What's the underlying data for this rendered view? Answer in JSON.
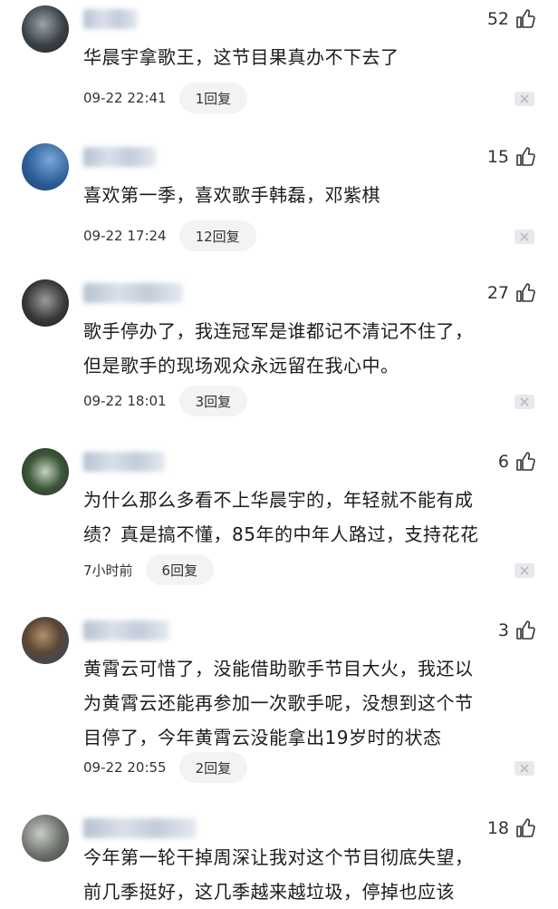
{
  "comments": [
    {
      "likes": "52",
      "text_lines": [
        "华晨宇拿歌王，这节目果真办不下去了"
      ],
      "time": "09-22 22:41",
      "reply_label": "1回复",
      "avatar_colors": [
        "#3b4046",
        "#9aa3ab",
        "#22262a"
      ],
      "username_width": 60
    },
    {
      "likes": "15",
      "text_lines": [
        "喜欢第一季，喜欢歌手韩磊，邓紫棋"
      ],
      "time": "09-22 17:24",
      "reply_label": "12回复",
      "avatar_colors": [
        "#2d5f9a",
        "#7aa7d6",
        "#1d3f6b"
      ],
      "username_width": 80
    },
    {
      "likes": "27",
      "text_lines": [
        "歌手停办了，我连冠军是谁都记不清记不住了，",
        "但是歌手的现场观众永远留在我心中。"
      ],
      "time": "09-22 18:01",
      "reply_label": "3回复",
      "avatar_colors": [
        "#3a3a3a",
        "#9b9b9b",
        "#151515"
      ],
      "username_width": 110
    },
    {
      "likes": "6",
      "text_lines": [
        "为什么那么多看不上华晨宇的，年轻就不能有成",
        "绩？真是搞不懂，85年的中年人路过，支持花花"
      ],
      "time": "7小时前",
      "reply_label": "6回复",
      "avatar_colors": [
        "#3f5a3b",
        "#c7d3c2",
        "#1f2a1d"
      ],
      "username_width": 90
    },
    {
      "likes": "3",
      "text_lines": [
        "黄霄云可惜了，没能借助歌手节目大火，我还以",
        "为黄霄云还能再参加一次歌手呢，没想到这个节",
        "目停了，今年黄霄云没能拿出19岁时的状态"
      ],
      "time": "09-22 20:55",
      "reply_label": "2回复",
      "avatar_colors": [
        "#5b4634",
        "#b08f6d",
        "#2b4a73"
      ],
      "username_width": 95
    },
    {
      "likes": "18",
      "text_lines": [
        "今年第一轮干掉周深让我对这个节目彻底失望，",
        "前几季挺好，这几季越来越垃圾，停掉也应该"
      ],
      "time": "",
      "reply_label": "",
      "avatar_colors": [
        "#6b6f6a",
        "#c9ccc6",
        "#3e423d"
      ],
      "username_width": 125
    }
  ],
  "icons": {
    "like": "thumbs-up-icon",
    "dismiss": "close-icon"
  }
}
